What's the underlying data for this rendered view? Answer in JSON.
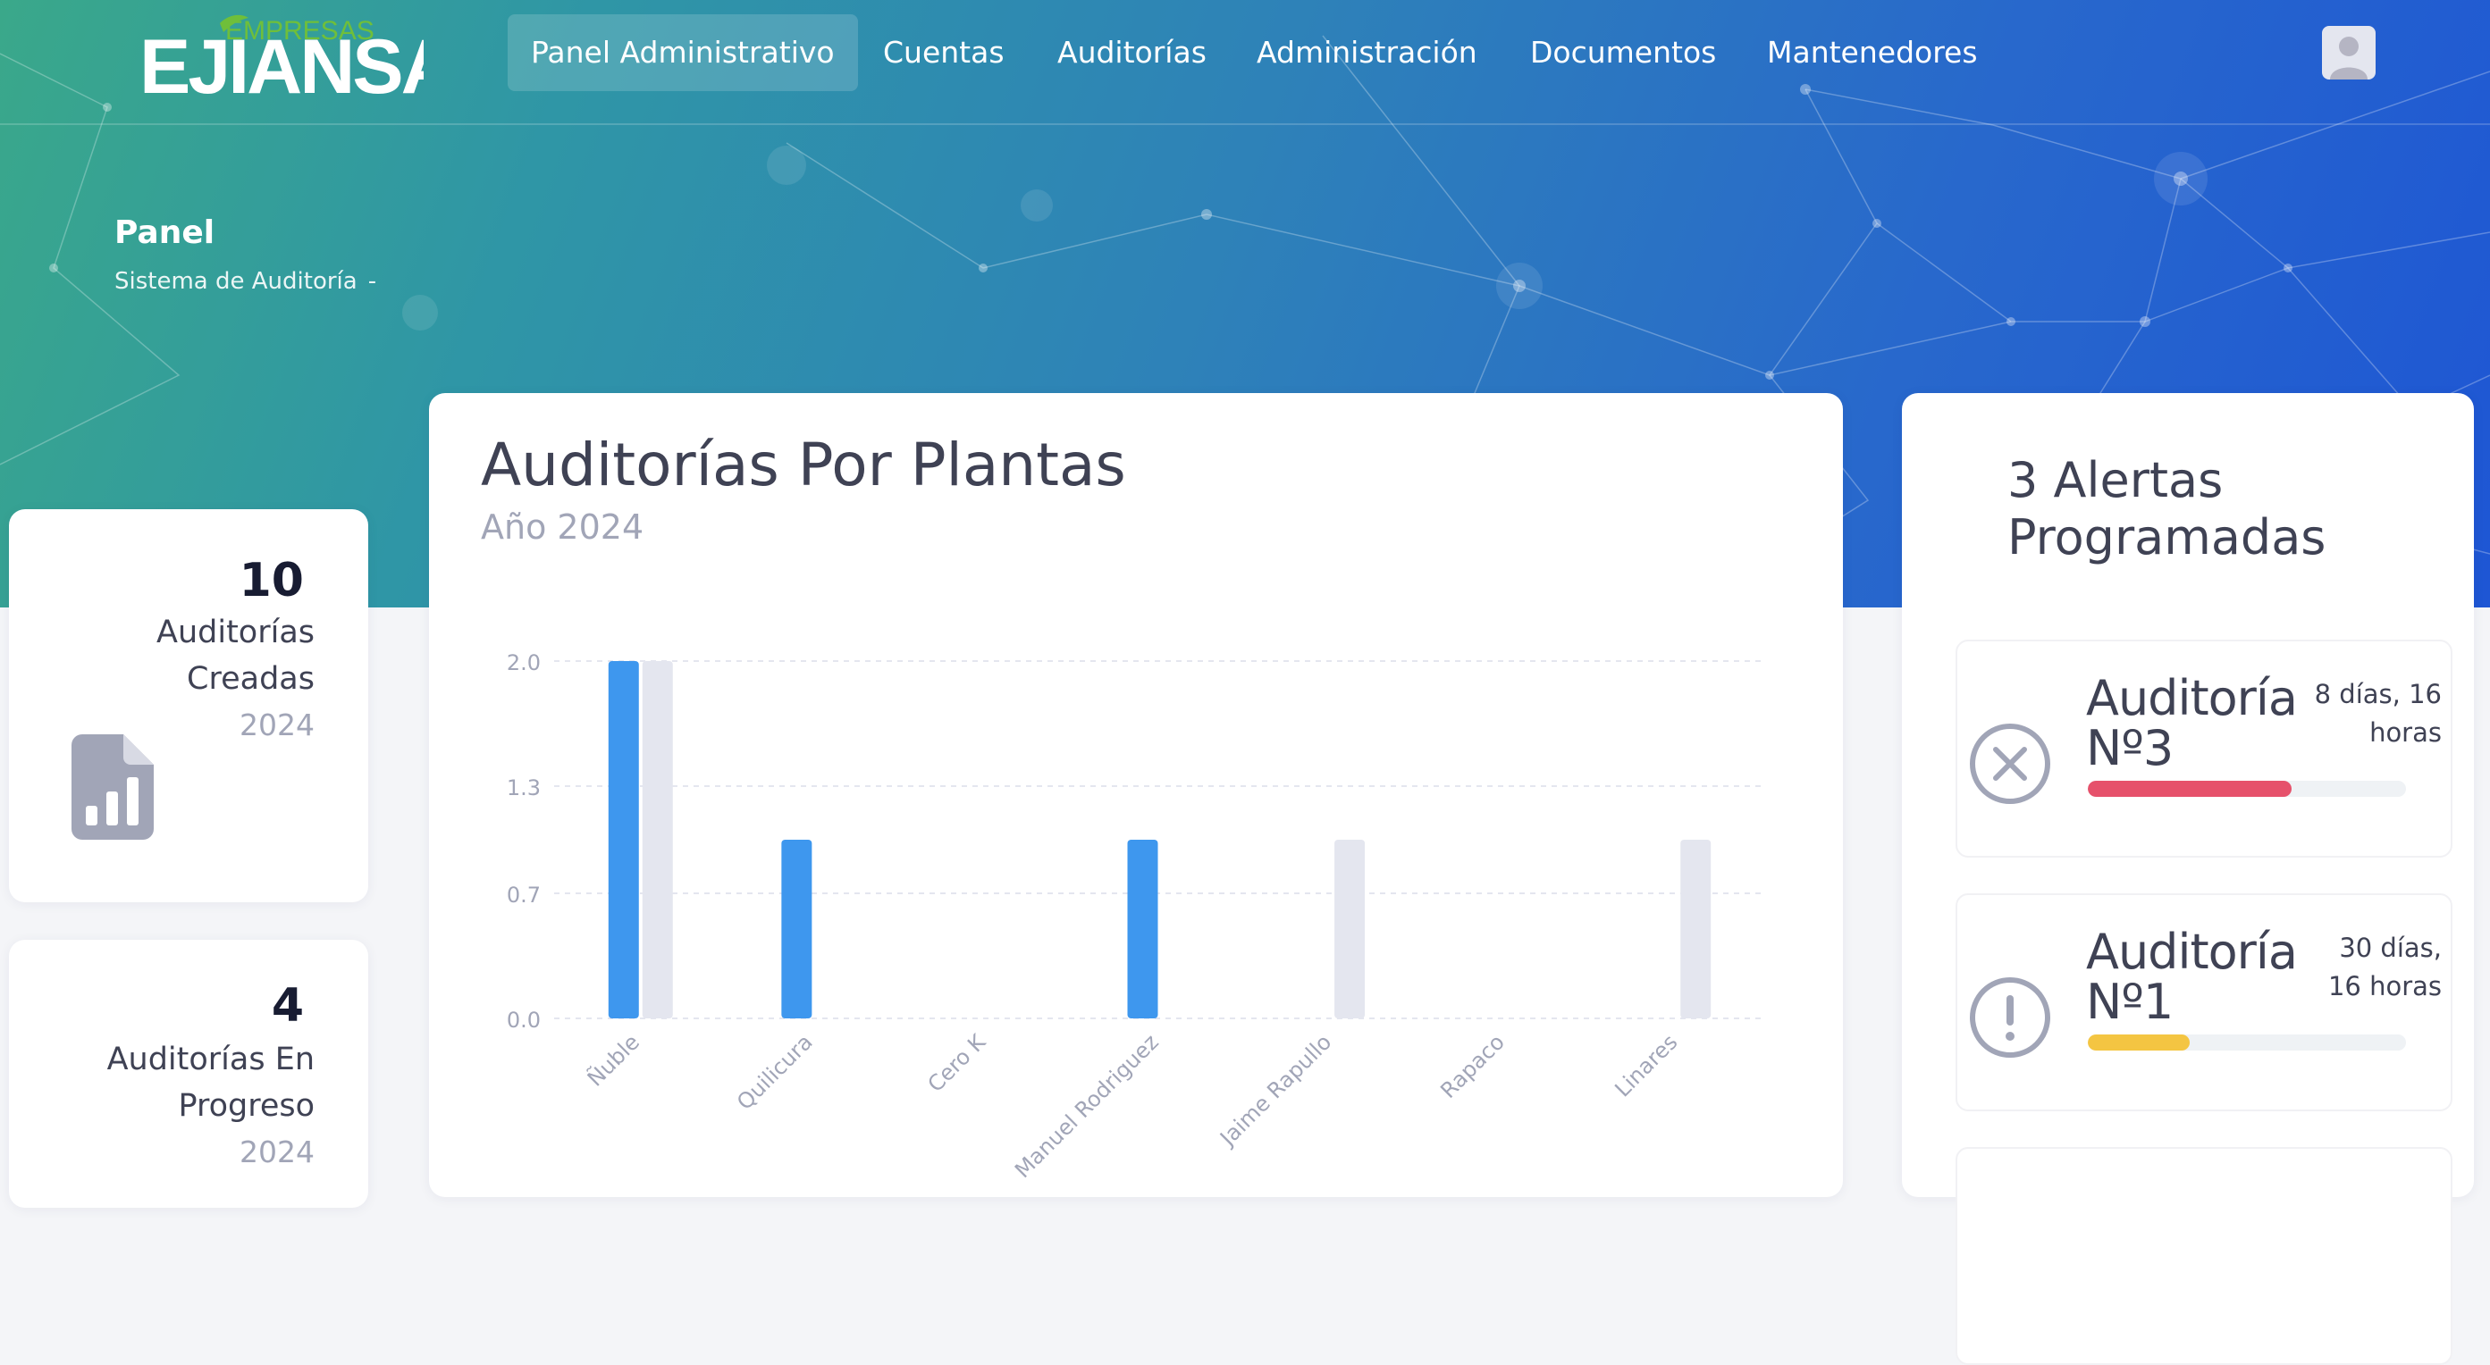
{
  "brand": {
    "logo_small": "EMPRESAS",
    "logo_big": "EJIANSA",
    "color_green": "#6fbf3a"
  },
  "nav": {
    "items": [
      {
        "label": "Panel Administrativo",
        "active": true
      },
      {
        "label": "Cuentas"
      },
      {
        "label": "Auditorías"
      },
      {
        "label": "Administración"
      },
      {
        "label": "Documentos"
      },
      {
        "label": "Mantenedores"
      }
    ],
    "user_icon": "user-avatar-icon"
  },
  "header": {
    "title": "Panel",
    "breadcrumb": "Sistema de Auditoría",
    "breadcrumb_sep": "-"
  },
  "stats": [
    {
      "value": "10",
      "label": "Auditorías Creadas",
      "year": "2024",
      "icon": "document-chart-icon"
    },
    {
      "value": "4",
      "label": "Auditorías En Progreso",
      "year": "2024"
    }
  ],
  "chart_card": {
    "title": "Auditorías Por Plantas",
    "subtitle": "Año 2024"
  },
  "chart_data": {
    "type": "bar",
    "categories": [
      "Ñuble",
      "Quilicura",
      "Cero K",
      "Manuel Rodriguez",
      "Jaime Rapullo",
      "Rapaco",
      "Linares"
    ],
    "series": [
      {
        "values": [
          2,
          1,
          0,
          1,
          0,
          0,
          0
        ],
        "color": "#3e97ee"
      },
      {
        "values": [
          2,
          0,
          0,
          0,
          1,
          0,
          1
        ],
        "color": "#e4e6ef"
      }
    ],
    "yticks": [
      "0.0",
      "0.7",
      "1.3",
      "2.0"
    ],
    "ylim": [
      0,
      2
    ],
    "grid": true
  },
  "alerts": {
    "title": "3 Alertas Programadas",
    "items": [
      {
        "name": "Auditoría Nº3",
        "time": "8 días, 16 horas",
        "progress": 0.64,
        "color": "#e6516b",
        "icon": "close-circle-icon"
      },
      {
        "name": "Auditoría Nº1",
        "time": "30 días, 16 horas",
        "progress": 0.32,
        "color": "#f4c542",
        "icon": "exclamation-circle-icon"
      }
    ]
  }
}
